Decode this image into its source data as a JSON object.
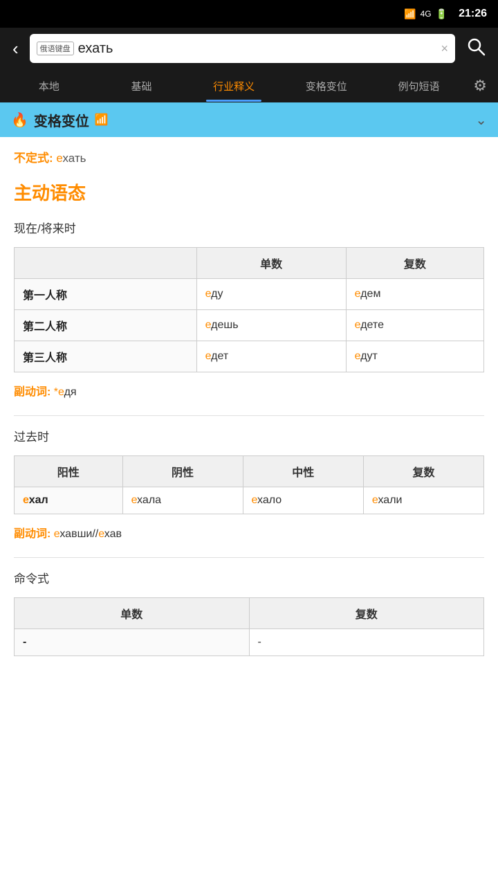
{
  "statusBar": {
    "time": "21:26",
    "signal": "4G/2G",
    "battery": "▮▮▮"
  },
  "searchBar": {
    "backLabel": "‹",
    "keyboardTag": "俄语键盘",
    "inputValue": "ехать",
    "clearLabel": "×",
    "searchLabel": "⌕"
  },
  "navTabs": [
    {
      "id": "local",
      "label": "本地",
      "active": false
    },
    {
      "id": "basic",
      "label": "基础",
      "active": false
    },
    {
      "id": "industry",
      "label": "行业释义",
      "active": true
    },
    {
      "id": "conjugation",
      "label": "变格变位",
      "active": false
    },
    {
      "id": "examples",
      "label": "例句短语",
      "active": false
    }
  ],
  "settings": "⚙",
  "sectionHeader": {
    "icon": "🔥",
    "title": "变格变位",
    "wifiIcon": "📶",
    "chevron": "⌄"
  },
  "infinitive": {
    "label": "不定式:",
    "prefix": "е",
    "rest": "хать"
  },
  "voiceHeading": "主动语态",
  "presentFuture": {
    "tenseLabel": "现在/将来时",
    "columns": [
      "",
      "单数",
      "复数"
    ],
    "rows": [
      {
        "person": "第一人称",
        "singular_prefix": "е",
        "singular_rest": "ду",
        "plural_prefix": "е",
        "plural_rest": "дем"
      },
      {
        "person": "第二人称",
        "singular_prefix": "е",
        "singular_rest": "дешь",
        "plural_prefix": "е",
        "plural_rest": "дете"
      },
      {
        "person": "第三人称",
        "singular_prefix": "е",
        "singular_rest": "дет",
        "plural_prefix": "е",
        "plural_rest": "дут"
      }
    ],
    "participleLabel": "副动词:",
    "participlePrefix": "*е",
    "participleRest": "дя"
  },
  "past": {
    "tenseLabel": "过去时",
    "columns": [
      "阳性",
      "阴性",
      "中性",
      "复数"
    ],
    "rows": [
      {
        "masc_prefix": "е",
        "masc_rest": "хал",
        "fem_prefix": "е",
        "fem_rest": "хала",
        "neut_prefix": "е",
        "neut_rest": "хало",
        "plur_prefix": "е",
        "plur_rest": "хали"
      }
    ],
    "participleLabel": "副动词:",
    "participle": "еха вши//ехав",
    "participleFormatted": "е",
    "participleRest1": "ха вши//",
    "participlePrefix2": "е",
    "participleRest2": "хав"
  },
  "imperative": {
    "tenseLabel": "命令式",
    "columns": [
      "单数",
      "复数"
    ],
    "rows": [
      {
        "singular": "-",
        "plural": "-"
      }
    ]
  }
}
